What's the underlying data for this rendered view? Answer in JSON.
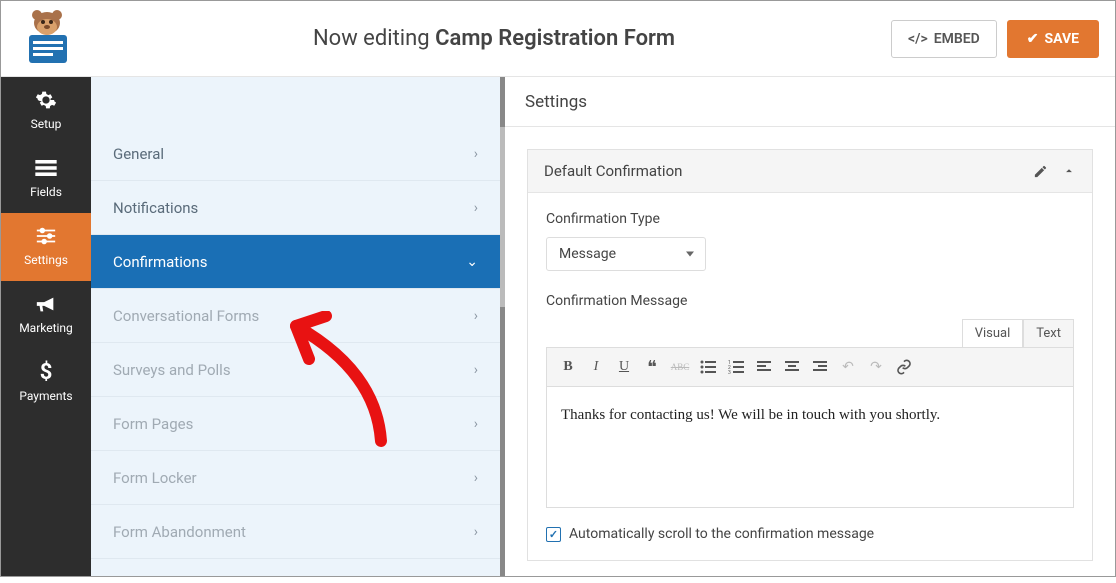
{
  "header": {
    "editing_prefix": "Now editing ",
    "form_name": "Camp Registration Form",
    "embed_label": "EMBED",
    "save_label": "SAVE"
  },
  "nav": {
    "items": [
      {
        "label": "Setup",
        "icon": "gear"
      },
      {
        "label": "Fields",
        "icon": "list"
      },
      {
        "label": "Settings",
        "icon": "sliders",
        "active": true
      },
      {
        "label": "Marketing",
        "icon": "bullhorn"
      },
      {
        "label": "Payments",
        "icon": "dollar"
      }
    ]
  },
  "sidebar": {
    "items": [
      {
        "label": "General"
      },
      {
        "label": "Notifications"
      },
      {
        "label": "Confirmations",
        "active": true,
        "expanded": true
      },
      {
        "label": "Conversational Forms",
        "dim": true
      },
      {
        "label": "Surveys and Polls",
        "dim": true
      },
      {
        "label": "Form Pages",
        "dim": true
      },
      {
        "label": "Form Locker",
        "dim": true
      },
      {
        "label": "Form Abandonment",
        "dim": true
      }
    ]
  },
  "main": {
    "heading": "Settings",
    "panel": {
      "title": "Default Confirmation",
      "type_label": "Confirmation Type",
      "type_value": "Message",
      "message_label": "Confirmation Message",
      "tabs": {
        "visual": "Visual",
        "text": "Text"
      },
      "message_content": "Thanks for contacting us! We will be in touch with you shortly.",
      "scroll_checkbox": {
        "checked": true,
        "label": "Automatically scroll to the confirmation message"
      }
    }
  }
}
